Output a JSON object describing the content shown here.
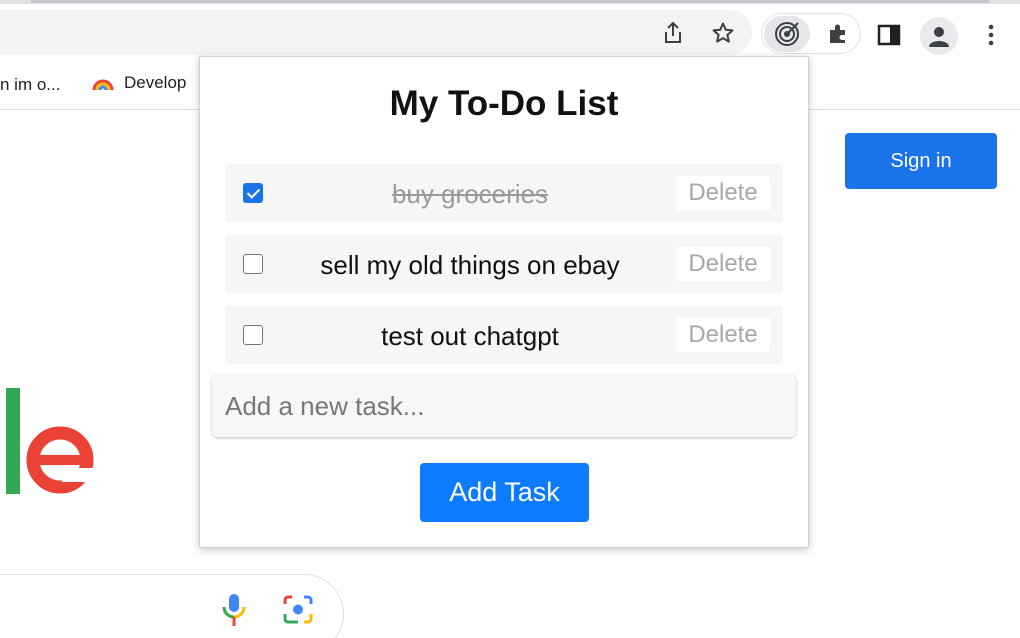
{
  "browser": {
    "icons": [
      "share-icon",
      "star-icon",
      "target-icon",
      "puzzle-icon",
      "side-panel-icon",
      "profile-icon",
      "menu-icon"
    ],
    "bookmarks": [
      {
        "label": "n im o..."
      },
      {
        "label": "Develop",
        "icon": "rainbow-icon"
      }
    ]
  },
  "page": {
    "signin_label": "Sign in",
    "logo_fragment": "le"
  },
  "popup": {
    "title": "My To-Do List",
    "tasks": [
      {
        "text": "buy groceries",
        "done": true,
        "delete_label": "Delete"
      },
      {
        "text": "sell my old things on ebay",
        "done": false,
        "delete_label": "Delete"
      },
      {
        "text": "test out chatgpt",
        "done": false,
        "delete_label": "Delete"
      }
    ],
    "new_task_placeholder": "Add a new task...",
    "add_button_label": "Add Task"
  },
  "colors": {
    "accent": "#0d7bff",
    "signin": "#1a73e8",
    "logo_l": "#34a853",
    "logo_e": "#ea4335"
  }
}
